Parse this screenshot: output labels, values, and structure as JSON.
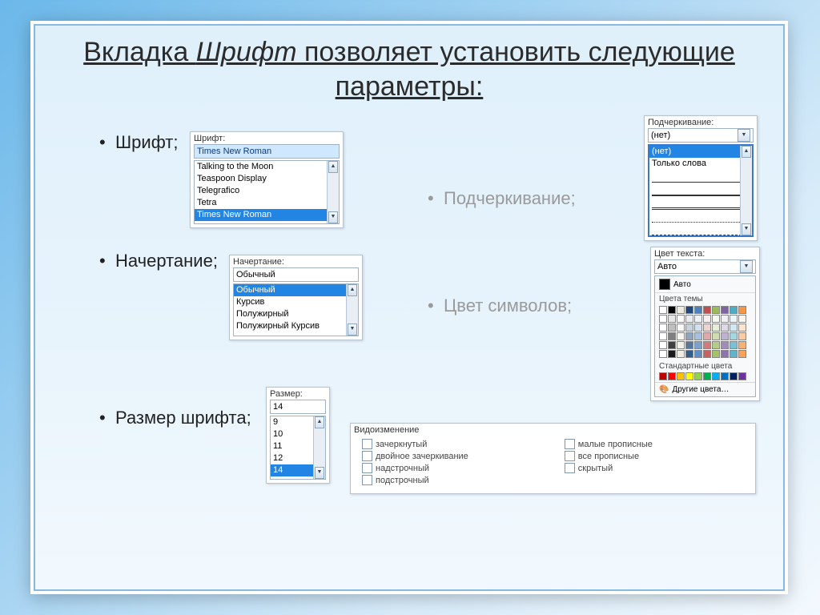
{
  "title": {
    "pre": "Вкладка ",
    "em": "Шрифт",
    "post": " позволяет установить следующие параметры:"
  },
  "bullets_left": [
    "Шрифт;",
    "Начертание;",
    "Размер шрифта;"
  ],
  "bullets_right": [
    "Подчеркивание;",
    "Цвет символов;"
  ],
  "font_panel": {
    "label": "Шрифт:",
    "value": "Times New Roman",
    "items": [
      "Talking to the Moon",
      "Teaspoon Display",
      "Telegrafico",
      "Tetra",
      "Times New Roman"
    ],
    "selected_index": 4
  },
  "style_panel": {
    "label": "Начертание:",
    "value": "Обычный",
    "items": [
      "Обычный",
      "Курсив",
      "Полужирный",
      "Полужирный Курсив"
    ],
    "selected_index": 0
  },
  "size_panel": {
    "label": "Размер:",
    "value": "14",
    "items": [
      "9",
      "10",
      "11",
      "12",
      "14"
    ],
    "selected_index": 4
  },
  "underline_panel": {
    "label": "Подчеркивание:",
    "value": "(нет)",
    "items": [
      "(нет)",
      "Только слова"
    ]
  },
  "color_panel": {
    "label": "Цвет текста:",
    "value": "Авто",
    "auto_item": "Авто",
    "theme_label": "Цвета темы",
    "std_label": "Стандартные цвета",
    "other_label": "Другие цвета…",
    "theme_colors_row1": [
      "#ffffff",
      "#000000",
      "#eeece1",
      "#1f497d",
      "#4f81bd",
      "#c0504d",
      "#9bbb59",
      "#8064a2",
      "#4bacc6",
      "#f79646"
    ],
    "theme_tints": [
      90,
      75,
      50,
      25,
      10
    ],
    "std_colors": [
      "#c00000",
      "#ff0000",
      "#ffc000",
      "#ffff00",
      "#92d050",
      "#00b050",
      "#00b0f0",
      "#0070c0",
      "#002060",
      "#7030a0"
    ]
  },
  "effects_panel": {
    "label": "Видоизменение",
    "left": [
      "зачеркнутый",
      "двойное зачеркивание",
      "надстрочный",
      "подстрочный"
    ],
    "right": [
      "малые прописные",
      "все прописные",
      "скрытый"
    ]
  }
}
